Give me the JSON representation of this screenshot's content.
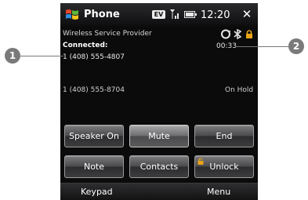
{
  "titlebar": {
    "app_title": "Phone",
    "ev_label": "EV",
    "time": "12:20",
    "close_glyph": "✕"
  },
  "call": {
    "provider": "Wireless Service Provider",
    "connected_label": "Connected:",
    "active_number": "1 (408) 555-4807",
    "timer": "00:33",
    "held_number": "1 (408) 555-8704",
    "held_status": "On Hold"
  },
  "buttons": {
    "speaker": "Speaker On",
    "mute": "Mute",
    "end": "End",
    "note": "Note",
    "contacts": "Contacts",
    "unlock": "Unlock"
  },
  "softkeys": {
    "left": "Keypad",
    "right": "Menu"
  },
  "callouts": {
    "one": "1",
    "two": "2"
  },
  "colors": {
    "screen_bg": "#0b0b0c",
    "lock_accent": "#e8a317",
    "callout_bg": "#7a7a7a"
  },
  "icons": [
    "windows-logo-icon",
    "signal-strength-icon",
    "battery-icon",
    "close-icon",
    "transfer-icon",
    "bluetooth-icon",
    "lock-icon"
  ]
}
